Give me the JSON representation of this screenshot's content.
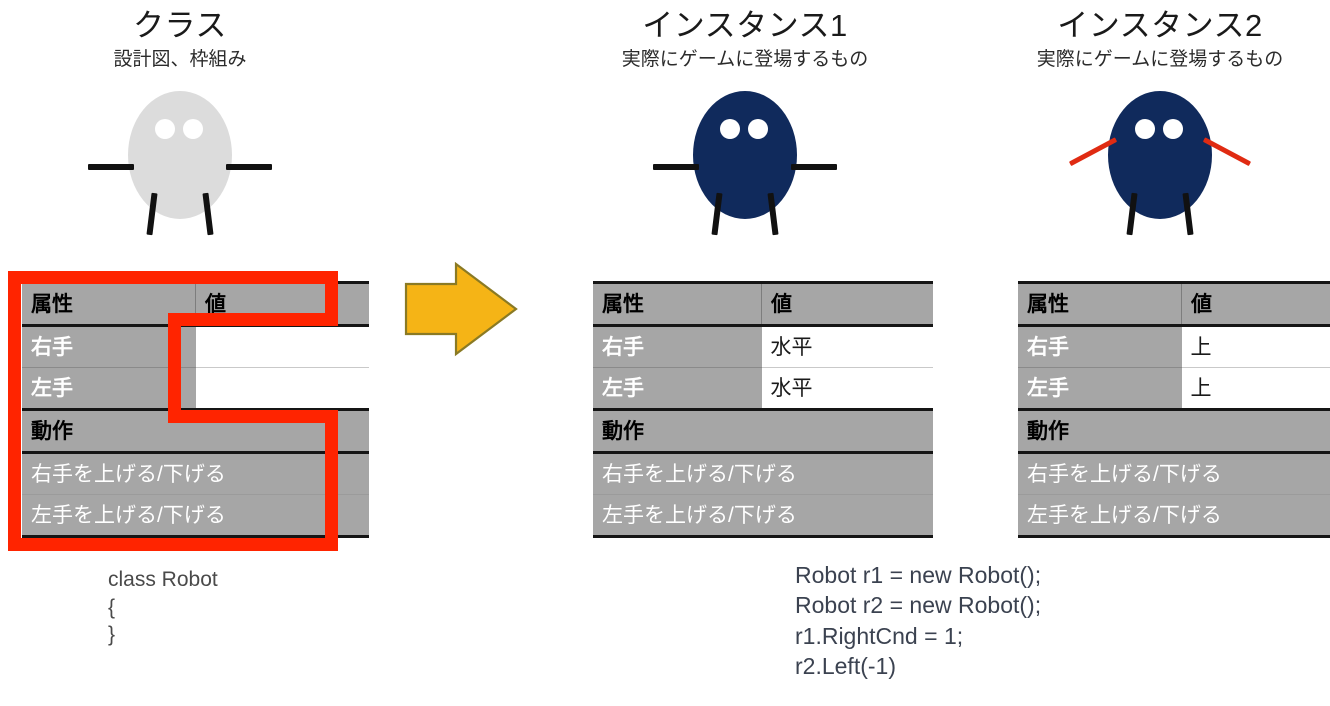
{
  "columns": {
    "class": {
      "title": "クラス",
      "subtitle": "設計図、枠組み",
      "robot_color": "#dcdcdc",
      "arm_style": "flat",
      "arm_color": "#111111"
    },
    "instance1": {
      "title": "インスタンス1",
      "subtitle": "実際にゲームに登場するもの",
      "robot_color": "#102a5c",
      "arm_style": "flat",
      "arm_color": "#111111"
    },
    "instance2": {
      "title": "インスタンス2",
      "subtitle": "実際にゲームに登場するもの",
      "robot_color": "#102a5c",
      "arm_style": "raised",
      "arm_color": "#e02b12"
    }
  },
  "table": {
    "header_attr": "属性",
    "header_value": "値",
    "section_label": "動作",
    "attributes": [
      "右手",
      "左手"
    ],
    "methods": [
      "右手を上げる/下げる",
      "左手を上げる/下げる"
    ],
    "values": {
      "class": [
        "",
        ""
      ],
      "instance1": [
        "水平",
        "水平"
      ],
      "instance2": [
        "上",
        "上"
      ]
    }
  },
  "code": {
    "class_code": "class Robot\n{\n}",
    "instance_code": "Robot r1 = new Robot();\nRobot r2 = new Robot();\nr1.RightCnd = 1;\nr2.Left(-1)"
  },
  "arrow": {
    "label": "transformation-arrow",
    "fill": "#F5B416",
    "stroke": "#8a7a24"
  },
  "highlight": {
    "label": "class-template-highlight",
    "color": "#ff2400"
  }
}
